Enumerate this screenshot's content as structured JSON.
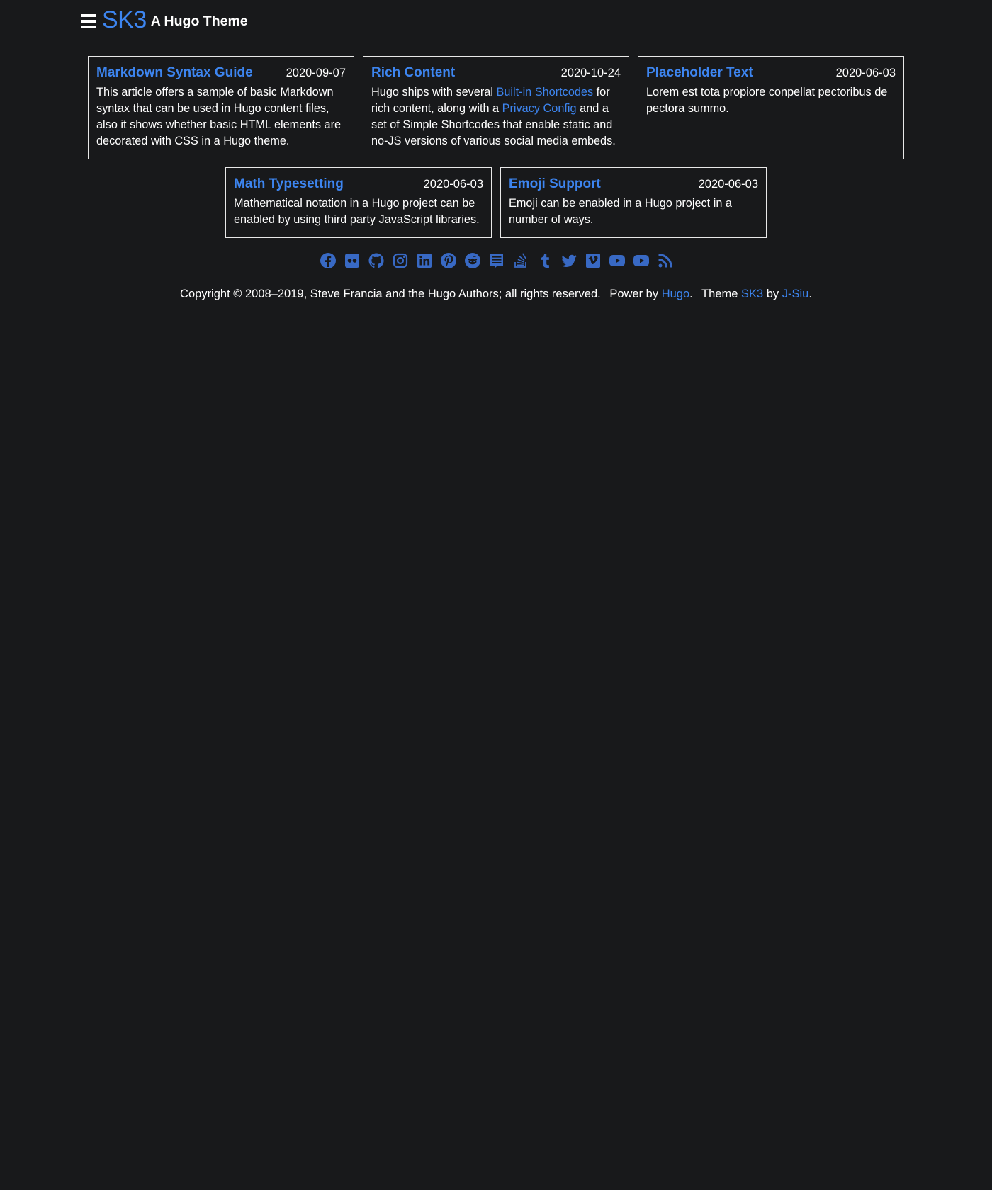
{
  "header": {
    "title": "SK3",
    "subtitle": "A Hugo Theme"
  },
  "posts": [
    {
      "title": "Markdown Syntax Guide",
      "date": "2020-09-07",
      "summary": "This article offers a sample of basic Markdown syntax that can be used in Hugo content files, also it shows whether basic HTML elements are decorated with CSS in a Hugo theme."
    },
    {
      "title": "Rich Content",
      "date": "2020-10-24",
      "summary_parts": {
        "p1": "Hugo ships with several ",
        "link1": "Built-in Shortcodes",
        "p2": " for rich content, along with a ",
        "link2": "Privacy Config",
        "p3": " and a set of Simple Shortcodes that enable static and no-JS versions of various social media embeds."
      }
    },
    {
      "title": "Placeholder Text",
      "date": "2020-06-03",
      "summary": "Lorem est tota propiore conpellat pectoribus de pectora summo."
    },
    {
      "title": "Math Typesetting",
      "date": "2020-06-03",
      "summary": "Mathematical notation in a Hugo project can be enabled by using third party JavaScript libraries."
    },
    {
      "title": "Emoji Support",
      "date": "2020-06-03",
      "summary": "Emoji can be enabled in a Hugo project in a number of ways."
    }
  ],
  "social_icons": [
    "facebook-icon",
    "flickr-icon",
    "github-icon",
    "instagram-icon",
    "linkedin-icon",
    "pinterest-icon",
    "reddit-icon",
    "slack-icon",
    "stackoverflow-icon",
    "tumblr-icon",
    "twitter-icon",
    "vimeo-icon",
    "youtube-icon",
    "youtube-icon",
    "rss-icon"
  ],
  "footer": {
    "copyright": "Copyright © 2008–2019, Steve Francia and the Hugo Authors; all rights reserved.",
    "power_prefix": "Power by ",
    "power_link": "Hugo",
    "power_suffix": ".",
    "theme_prefix": "Theme ",
    "theme_link": "SK3",
    "by_text": " by ",
    "author_link": "J-Siu",
    "end": "."
  },
  "colors": {
    "background": "#18191b",
    "accent": "#3d85f0",
    "icon": "#3869c4",
    "text": "#ffffff",
    "border": "#e8e8e8"
  }
}
